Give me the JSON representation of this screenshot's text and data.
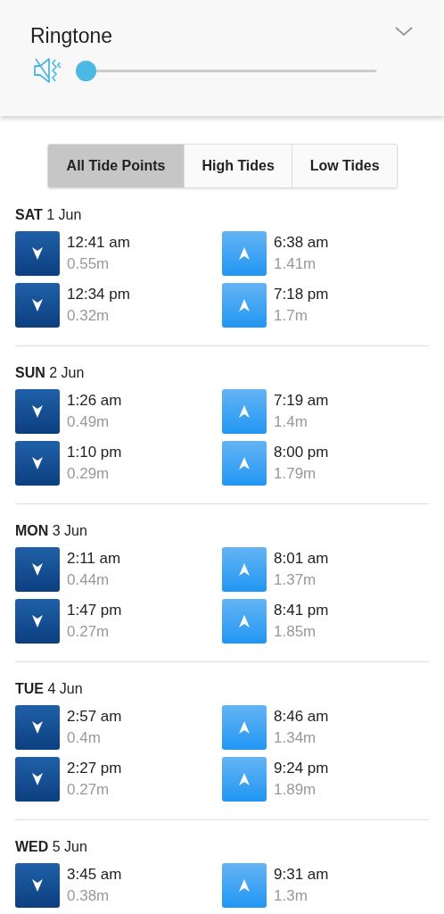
{
  "volume_panel": {
    "title": "Ringtone",
    "level": 0
  },
  "filter_tabs": [
    {
      "label": "All Tide Points",
      "selected": true
    },
    {
      "label": "High Tides",
      "selected": false
    },
    {
      "label": "Low Tides",
      "selected": false
    }
  ],
  "days": [
    {
      "heading": "**SAT** 1 Jun",
      "tides": [
        {
          "kind": "low",
          "time": "12:41 am",
          "height": "0.55m"
        },
        {
          "kind": "high",
          "time": "6:38 am",
          "height": "1.41m"
        },
        {
          "kind": "low",
          "time": "12:34 pm",
          "height": "0.32m"
        },
        {
          "kind": "high",
          "time": "7:18 pm",
          "height": "1.7m"
        }
      ]
    },
    {
      "heading": "**SUN** 2 Jun",
      "tides": [
        {
          "kind": "low",
          "time": "1:26 am",
          "height": "0.49m"
        },
        {
          "kind": "high",
          "time": "7:19 am",
          "height": "1.4m"
        },
        {
          "kind": "low",
          "time": "1:10 pm",
          "height": "0.29m"
        },
        {
          "kind": "high",
          "time": "8:00 pm",
          "height": "1.79m"
        }
      ]
    },
    {
      "heading": "**MON** 3 Jun",
      "tides": [
        {
          "kind": "low",
          "time": "2:11 am",
          "height": "0.44m"
        },
        {
          "kind": "high",
          "time": "8:01 am",
          "height": "1.37m"
        },
        {
          "kind": "low",
          "time": "1:47 pm",
          "height": "0.27m"
        },
        {
          "kind": "high",
          "time": "8:41 pm",
          "height": "1.85m"
        }
      ]
    },
    {
      "heading": "**TUE** 4 Jun",
      "tides": [
        {
          "kind": "low",
          "time": "2:57 am",
          "height": "0.4m"
        },
        {
          "kind": "high",
          "time": "8:46 am",
          "height": "1.34m"
        },
        {
          "kind": "low",
          "time": "2:27 pm",
          "height": "0.27m"
        },
        {
          "kind": "high",
          "time": "9:24 pm",
          "height": "1.89m"
        }
      ]
    },
    {
      "heading": "**WED** 5 Jun",
      "tides": [
        {
          "kind": "low",
          "time": "3:45 am",
          "height": "0.38m"
        },
        {
          "kind": "high",
          "time": "9:31 am",
          "height": "1.3m"
        }
      ]
    }
  ]
}
